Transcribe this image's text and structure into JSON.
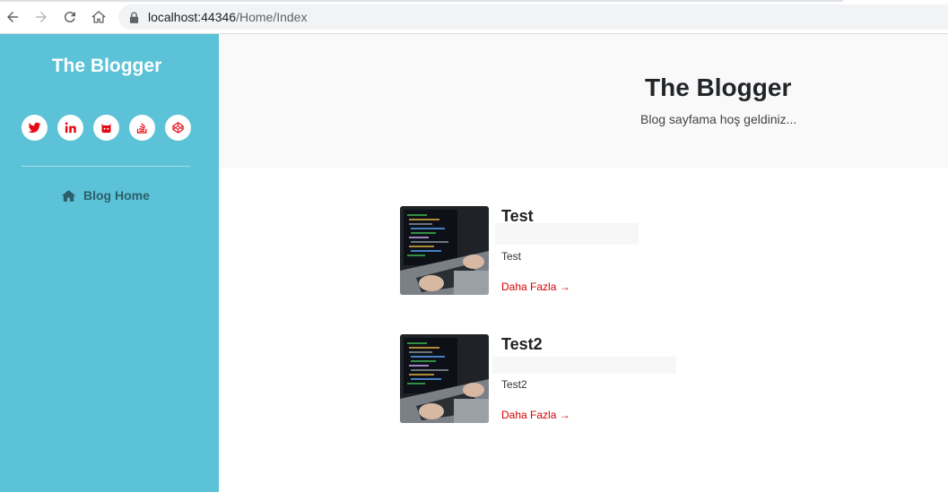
{
  "browser": {
    "url_host": "localhost:44346",
    "url_path": "/Home/Index"
  },
  "sidebar": {
    "brand": "The Blogger",
    "social_links": [
      {
        "icon": "twitter-icon"
      },
      {
        "icon": "linkedin-icon"
      },
      {
        "icon": "github-icon"
      },
      {
        "icon": "stackoverflow-icon"
      },
      {
        "icon": "codepen-icon"
      }
    ],
    "social_icon_color": "#e50914",
    "nav": [
      {
        "label": "Blog Home",
        "icon": "home-icon"
      }
    ]
  },
  "hero": {
    "title": "The Blogger",
    "subtitle": "Blog sayfama hoş geldiniz..."
  },
  "posts": [
    {
      "title": "Test",
      "excerpt": "Test",
      "more_label": "Daha Fazla →",
      "thumbnail": "laptop-coding-image"
    },
    {
      "title": "Test2",
      "excerpt": "Test2",
      "more_label": "Daha Fazla →",
      "thumbnail": "laptop-coding-image"
    }
  ],
  "colors": {
    "sidebar_bg": "#5bc2d7",
    "hero_bg": "#f9f9f9",
    "link_red": "#d60000"
  }
}
